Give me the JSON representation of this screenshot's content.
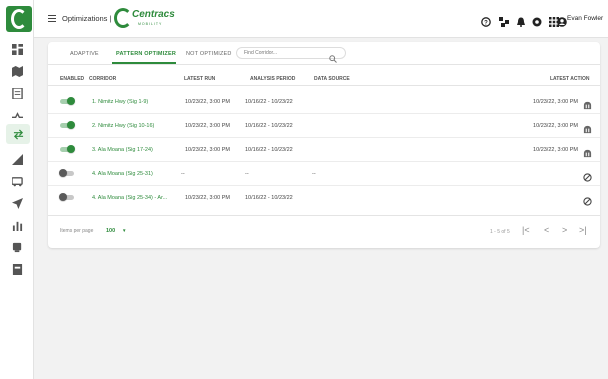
{
  "header": {
    "breadcrumb": "Optimizations |",
    "brand_name": "Centracs",
    "brand_sub": "MOBILITY",
    "user_name": "Evan Fowler"
  },
  "tabs": [
    {
      "label": "ADAPTIVE",
      "active": false
    },
    {
      "label": "PATTERN OPTIMIZER",
      "active": true
    },
    {
      "label": "NOT OPTIMIZED",
      "active": false
    }
  ],
  "search": {
    "placeholder": "Find Corridor..."
  },
  "columns": [
    "ENABLED",
    "CORRIDOR",
    "LATEST RUN",
    "ANALYSIS PERIOD",
    "DATA SOURCE",
    "LATEST ACTION"
  ],
  "rows": [
    {
      "enabled": true,
      "corridor": "1. Nimitz Hwy (Sig 1-9)",
      "latest_run": "10/23/22, 3:00 PM",
      "analysis_period": "10/16/22 - 10/23/22",
      "data_source": "",
      "latest_action": "10/23/22, 3:00 PM",
      "action_icon": "run-icon"
    },
    {
      "enabled": true,
      "corridor": "2. Nimitz Hwy (Sig 10-16)",
      "latest_run": "10/23/22, 3:00 PM",
      "analysis_period": "10/16/22 - 10/23/22",
      "data_source": "",
      "latest_action": "10/23/22, 3:00 PM",
      "action_icon": "run-icon"
    },
    {
      "enabled": true,
      "corridor": "3. Ala Moana (Sig 17-24)",
      "latest_run": "10/23/22, 3:00 PM",
      "analysis_period": "10/16/22 - 10/23/22",
      "data_source": "",
      "latest_action": "10/23/22, 3:00 PM",
      "action_icon": "run-icon"
    },
    {
      "enabled": false,
      "corridor": "4. Ala Moana (Sig 25-31)",
      "latest_run": "--",
      "analysis_period": "--",
      "data_source": "--",
      "latest_action": "",
      "action_icon": "disabled-icon"
    },
    {
      "enabled": false,
      "corridor": "4. Ala Moana (Sig 25-34) - Ar...",
      "latest_run": "10/23/22, 3:00 PM",
      "analysis_period": "10/16/22 - 10/23/22",
      "data_source": "",
      "latest_action": "",
      "action_icon": "disabled-icon"
    }
  ],
  "pagination": {
    "items_per_page_label": "Items per page",
    "items_per_page_value": "100",
    "range": "1 - 5 of 5",
    "first": "|<",
    "prev": "<",
    "next": ">",
    "last": ">|"
  },
  "colors": {
    "accent": "#2e8b3c",
    "toggle_on_track": "#a6cfae",
    "toggle_off_knob": "#5a5a5a"
  }
}
